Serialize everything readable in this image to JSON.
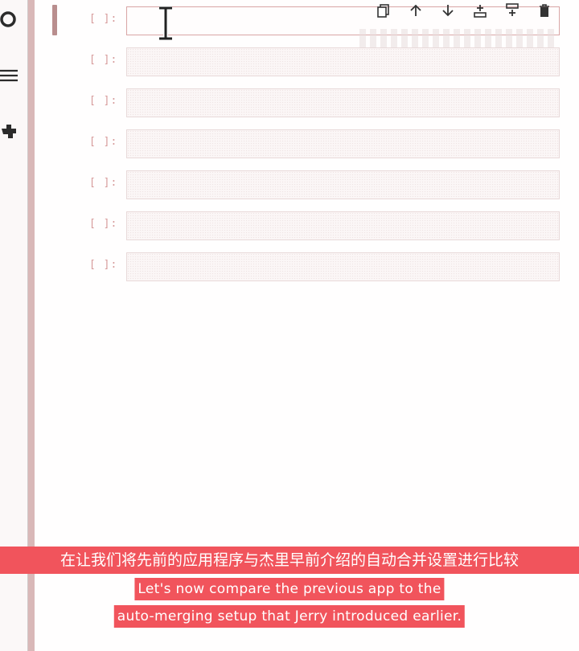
{
  "sidebar": {
    "icons": [
      "circle-icon",
      "list-icon",
      "puzzle-icon"
    ]
  },
  "cell_toolbar": {
    "buttons": [
      "duplicate-icon",
      "move-up-icon",
      "move-down-icon",
      "insert-above-icon",
      "insert-below-icon",
      "delete-icon"
    ]
  },
  "cells": [
    {
      "prompt": "[ ]:",
      "content": "",
      "active": true
    },
    {
      "prompt": "[ ]:",
      "content": "",
      "active": false
    },
    {
      "prompt": "[ ]:",
      "content": "",
      "active": false
    },
    {
      "prompt": "[ ]:",
      "content": "",
      "active": false
    },
    {
      "prompt": "[ ]:",
      "content": "",
      "active": false
    },
    {
      "prompt": "[ ]:",
      "content": "",
      "active": false
    },
    {
      "prompt": "[ ]:",
      "content": "",
      "active": false
    }
  ],
  "subtitles": {
    "zh": "在让我们将先前的应用程序与杰里早前介绍的自动合并设置进行比较",
    "en_line1": "Let's now compare the previous app to the",
    "en_line2": "auto-merging setup that Jerry introduced earlier."
  },
  "colors": {
    "subtitle_bg": "#f1545c",
    "prompt": "#d69a9a",
    "divider": "#d9b8b8"
  }
}
